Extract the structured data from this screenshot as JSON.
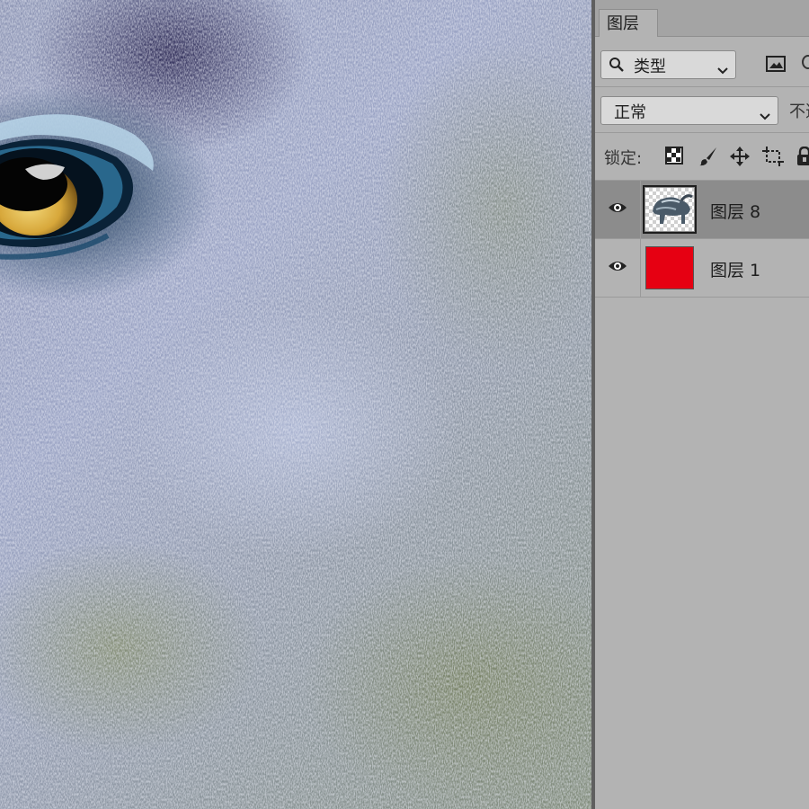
{
  "panel": {
    "tab_label": "图层",
    "filter": {
      "kind_value": "类型",
      "kind_icon": "search-icon"
    },
    "blend_mode": "正常",
    "opacity_label": "不透明度:",
    "lock_label": "锁定:",
    "lock_icons": [
      "lock-transparent-pixels-icon",
      "lock-image-pixels-icon",
      "lock-position-icon",
      "lock-artboard-icon",
      "lock-all-icon"
    ],
    "layers": [
      {
        "name": "图层 8",
        "visible": true,
        "selected": true,
        "thumb": "animal-image"
      },
      {
        "name": "图层 1",
        "visible": true,
        "selected": false,
        "thumb": "solid-fill",
        "fill_color": "#e60012"
      }
    ]
  },
  "colors": {
    "panel_bg": "#b3b3b3",
    "selected_row": "#8c8c8c",
    "layer1_fill": "#e60012"
  }
}
